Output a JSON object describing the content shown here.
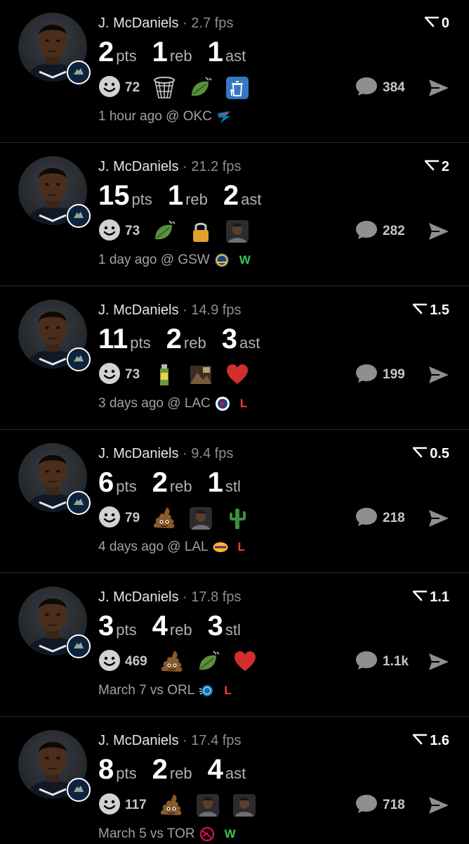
{
  "colors": {
    "background": "#000000",
    "win": "#34c759",
    "loss": "#ff3b30",
    "muted": "#8e8e93"
  },
  "posts": [
    {
      "player": "J. McDaniels",
      "sep": "·",
      "fps": "2.7 fps",
      "rank": "0",
      "stats": [
        {
          "value": "2",
          "unit": "pts"
        },
        {
          "value": "1",
          "unit": "reb"
        },
        {
          "value": "1",
          "unit": "ast"
        }
      ],
      "smiley_count": "72",
      "reactions": [
        "basketball-net-icon",
        "leaf-wind-icon",
        "trash-can-icon"
      ],
      "comments": "384",
      "time": "1 hour ago",
      "venue": "@ OKC",
      "opponent_logo": "thunder-logo-icon",
      "result": ""
    },
    {
      "player": "J. McDaniels",
      "sep": "·",
      "fps": "21.2 fps",
      "rank": "2",
      "stats": [
        {
          "value": "15",
          "unit": "pts"
        },
        {
          "value": "1",
          "unit": "reb"
        },
        {
          "value": "2",
          "unit": "ast"
        }
      ],
      "smiley_count": "73",
      "reactions": [
        "leaf-wind-icon",
        "lock-icon",
        "person-face-icon"
      ],
      "comments": "282",
      "time": "1 day ago",
      "venue": "@ GSW",
      "opponent_logo": "warriors-logo-icon",
      "result": "W"
    },
    {
      "player": "J. McDaniels",
      "sep": "·",
      "fps": "14.9 fps",
      "rank": "1.5",
      "stats": [
        {
          "value": "11",
          "unit": "pts"
        },
        {
          "value": "2",
          "unit": "reb"
        },
        {
          "value": "3",
          "unit": "ast"
        }
      ],
      "smiley_count": "73",
      "reactions": [
        "bottle-icon",
        "image-sticker-icon",
        "red-heart-icon"
      ],
      "comments": "199",
      "time": "3 days ago",
      "venue": "@ LAC",
      "opponent_logo": "clippers-logo-icon",
      "result": "L"
    },
    {
      "player": "J. McDaniels",
      "sep": "·",
      "fps": "9.4 fps",
      "rank": "0.5",
      "stats": [
        {
          "value": "6",
          "unit": "pts"
        },
        {
          "value": "2",
          "unit": "reb"
        },
        {
          "value": "1",
          "unit": "stl"
        }
      ],
      "smiley_count": "79",
      "reactions": [
        "poop-icon",
        "person-face-icon",
        "cactus-icon"
      ],
      "comments": "218",
      "time": "4 days ago",
      "venue": "@ LAL",
      "opponent_logo": "lakers-logo-icon",
      "result": "L"
    },
    {
      "player": "J. McDaniels",
      "sep": "·",
      "fps": "17.8 fps",
      "rank": "1.1",
      "stats": [
        {
          "value": "3",
          "unit": "pts"
        },
        {
          "value": "4",
          "unit": "reb"
        },
        {
          "value": "3",
          "unit": "stl"
        }
      ],
      "smiley_count": "469",
      "reactions": [
        "poop-icon",
        "leaf-wind-icon",
        "red-heart-icon"
      ],
      "comments": "1.1k",
      "time": "March 7",
      "venue": "vs ORL",
      "opponent_logo": "magic-logo-icon",
      "result": "L"
    },
    {
      "player": "J. McDaniels",
      "sep": "·",
      "fps": "17.4 fps",
      "rank": "1.6",
      "stats": [
        {
          "value": "8",
          "unit": "pts"
        },
        {
          "value": "2",
          "unit": "reb"
        },
        {
          "value": "4",
          "unit": "ast"
        }
      ],
      "smiley_count": "117",
      "reactions": [
        "poop-icon",
        "person-face-icon",
        "person-face-icon"
      ],
      "comments": "718",
      "time": "March 5",
      "venue": "vs TOR",
      "opponent_logo": "raptors-logo-icon",
      "result": "W"
    }
  ]
}
